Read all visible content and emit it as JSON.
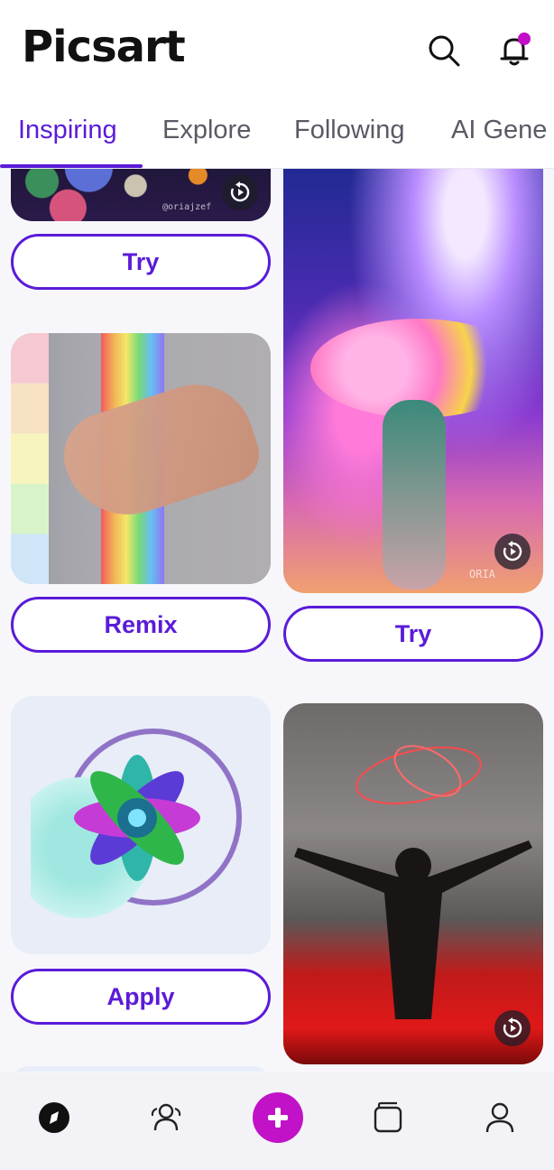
{
  "app": {
    "logo": "Picsart",
    "accent_color": "#5a1bd8",
    "brand_color": "#c112c7"
  },
  "header": {
    "search_icon": "search-icon",
    "notification_icon": "bell-icon",
    "has_unread_notifications": true
  },
  "tabs": [
    {
      "label": "Inspiring",
      "active": true
    },
    {
      "label": "Explore",
      "active": false
    },
    {
      "label": "Following",
      "active": false
    },
    {
      "label": "AI Gene",
      "active": false
    }
  ],
  "feed": {
    "left": [
      {
        "button": "Try",
        "caption": "@oriajzef",
        "kind": "planets"
      },
      {
        "button": "Remix",
        "kind": "rainbow-hand"
      },
      {
        "button": "Apply",
        "kind": "neon-flower"
      }
    ],
    "right": [
      {
        "button": "Try",
        "caption": "ORIA",
        "kind": "space-bouquet"
      },
      {
        "kind": "red-silhouette"
      }
    ]
  },
  "bottom_nav": {
    "items": [
      {
        "icon": "compass-icon",
        "active": true
      },
      {
        "icon": "community-icon",
        "active": false
      },
      {
        "icon": "plus-icon",
        "active": false
      },
      {
        "icon": "projects-icon",
        "active": false
      },
      {
        "icon": "profile-icon",
        "active": false
      }
    ]
  }
}
